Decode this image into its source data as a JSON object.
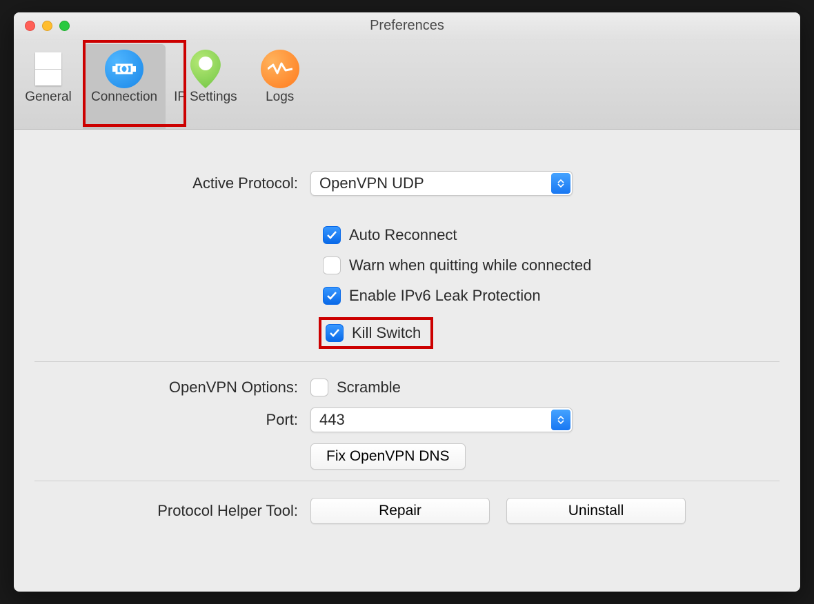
{
  "window": {
    "title": "Preferences"
  },
  "tabs": {
    "general": "General",
    "connection": "Connection",
    "ip_settings": "IP Settings",
    "logs": "Logs"
  },
  "form": {
    "active_protocol_label": "Active Protocol:",
    "active_protocol_value": "OpenVPN UDP",
    "auto_reconnect": "Auto Reconnect",
    "warn_quit": "Warn when quitting while connected",
    "ipv6_leak": "Enable IPv6 Leak Protection",
    "kill_switch": "Kill Switch",
    "openvpn_options_label": "OpenVPN Options:",
    "scramble": "Scramble",
    "port_label": "Port:",
    "port_value": "443",
    "fix_dns": "Fix OpenVPN DNS",
    "helper_label": "Protocol Helper Tool:",
    "repair": "Repair",
    "uninstall": "Uninstall"
  }
}
